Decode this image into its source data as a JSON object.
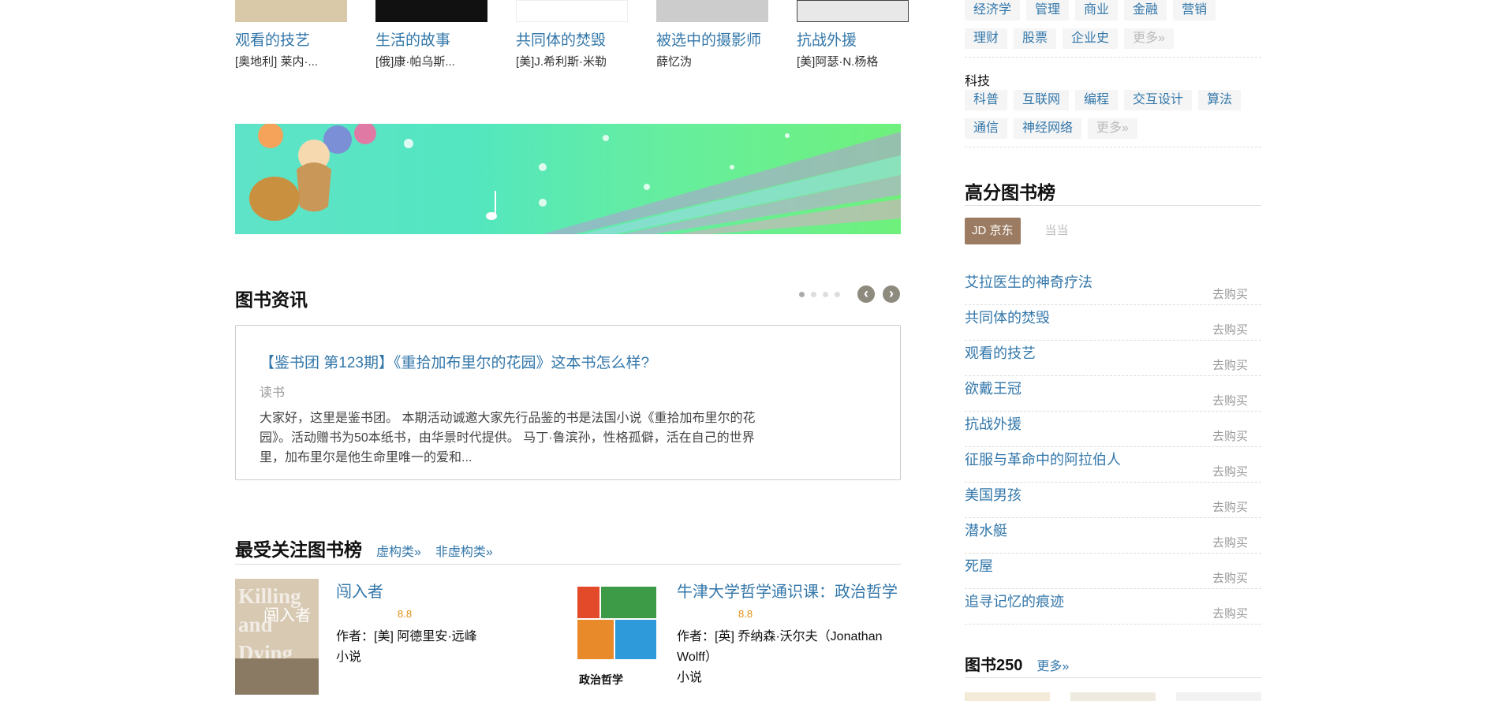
{
  "books_row": [
    {
      "title": "观看的技艺",
      "author": "[奥地利] 莱内·..."
    },
    {
      "title": "生活的故事",
      "author": "[俄]康·帕乌斯..."
    },
    {
      "title": "共同体的焚毁",
      "author": "[美]J.希利斯·米勒"
    },
    {
      "title": "被选中的摄影师",
      "author": "薛忆沩"
    },
    {
      "title": "抗战外援",
      "author": "[美]阿瑟·N.杨格"
    }
  ],
  "news": {
    "heading": "图书资讯",
    "title": "【鉴书团 第123期】《重拾加布里尔的花园》这本书怎么样?",
    "source": "读书",
    "body": "大家好，这里是鉴书团。 本期活动诚邀大家先行品鉴的书是法国小说《重拾加布里尔的花园》。活动赠书为50本纸书，由华景时代提供。 马丁·鲁滨孙，性格孤僻，活在自己的世界里，加布里尔是他生命里唯一的爱和...",
    "prev": "‹",
    "next": "›"
  },
  "top_list": {
    "heading": "最受关注图书榜",
    "fiction_link": "虚构类»",
    "nonfiction_link": "非虚构类»",
    "items": [
      {
        "title": "闯入者",
        "rating": "8.8",
        "author": "作者：[美] 阿德里安·远峰",
        "category": "小说",
        "cover_text": "闯入者",
        "cover_bg": "Killing and Dying"
      },
      {
        "title": "牛津大学哲学通识课：政治哲学",
        "rating": "8.8",
        "author": "作者：[英] 乔纳森·沃尔夫（Jonathan Wolff）",
        "category": "小说",
        "cover_text": "政治哲学"
      }
    ]
  },
  "tags": {
    "econ_row1": [
      "经济学",
      "管理",
      "商业",
      "金融",
      "营销"
    ],
    "econ_row2": [
      "理财",
      "股票",
      "企业史"
    ],
    "more": "更多»",
    "tech_title": "科技",
    "tech_row1": [
      "科普",
      "互联网",
      "编程",
      "交互设计",
      "算法"
    ],
    "tech_row2": [
      "通信",
      "神经网络"
    ]
  },
  "high_rank": {
    "heading": "高分图书榜",
    "stores": [
      "JD 京东",
      "当当"
    ],
    "buy_label": "去购买",
    "items": [
      "艾拉医生的神奇疗法",
      "共同体的焚毁",
      "观看的技艺",
      "欲戴王冠",
      "抗战外援",
      "征服与革命中的阿拉伯人",
      "美国男孩",
      "潜水艇",
      "死屋",
      "追寻记忆的痕迹"
    ]
  },
  "book250": {
    "heading": "图书250",
    "more": "更多»"
  },
  "colors": {
    "link": "#3377aa",
    "rating": "#e09015",
    "jd_tab": "#9b7b61"
  }
}
